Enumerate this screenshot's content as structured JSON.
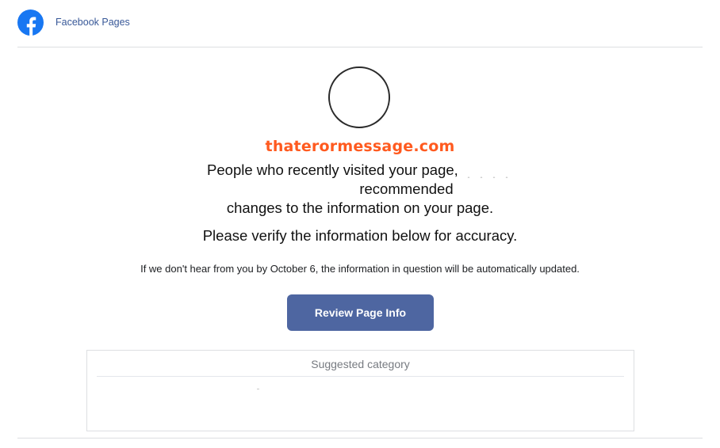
{
  "header": {
    "logo_icon": "facebook-logo-icon",
    "brand_color": "#1877f2",
    "title": "Facebook Pages"
  },
  "avatar": {
    "icon": "page-profile-avatar"
  },
  "watermark": {
    "text": "thaterormessage.com",
    "color": "#ff5a1f"
  },
  "message": {
    "line1": "People who recently visited your page,",
    "line2": "recommended",
    "line3": "changes to the information on your page.",
    "verify": "Please verify the information below for accuracy.",
    "notice": "If we don't hear from you by October 6, the information in question will be automatically updated."
  },
  "button": {
    "label": "Review Page Info",
    "color": "#4e66a1"
  },
  "suggestion_panel": {
    "header": "Suggested category"
  }
}
